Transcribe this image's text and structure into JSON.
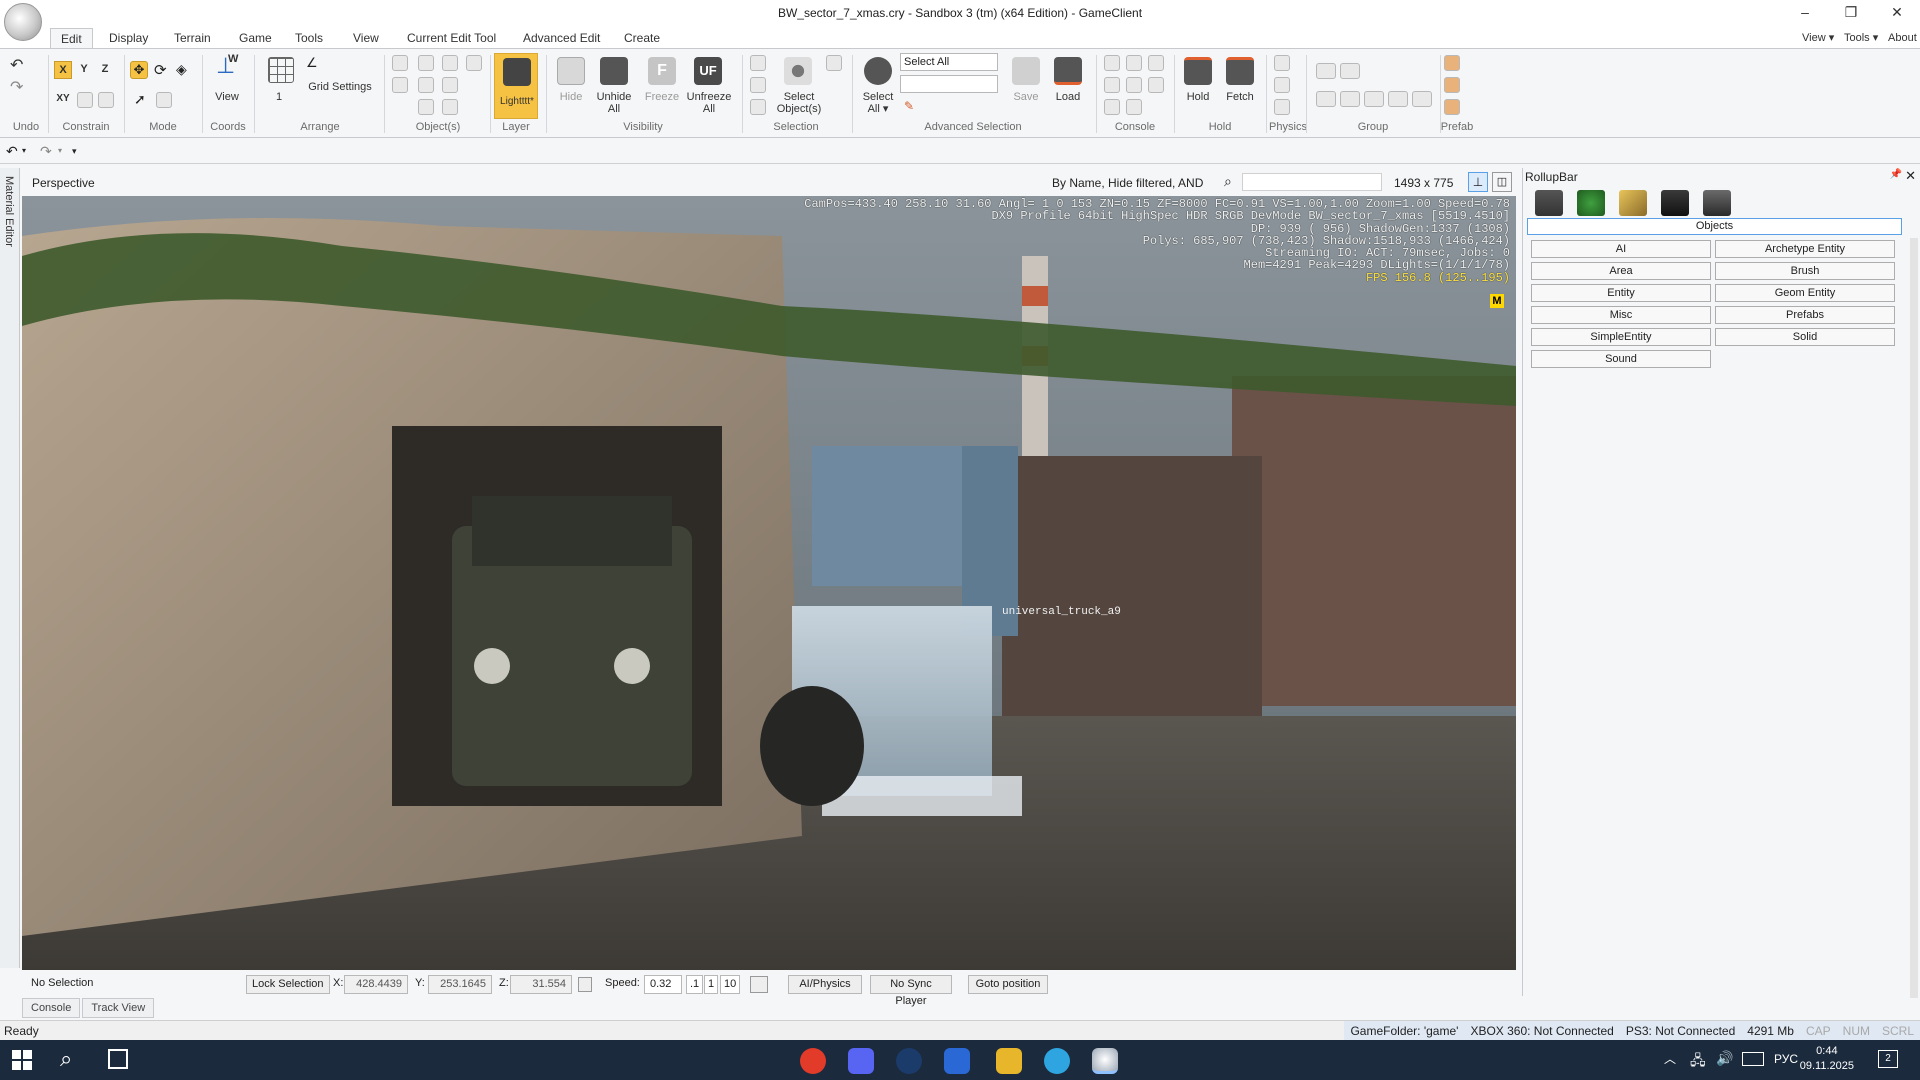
{
  "window": {
    "title": "BW_sector_7_xmas.cry - Sandbox 3 (tm) (x64 Edition) - GameClient",
    "controls": {
      "minimize": "–",
      "maximize": "❐",
      "close": "✕"
    }
  },
  "menu_tabs": [
    "Edit",
    "Display",
    "Terrain",
    "Game",
    "Tools",
    "View",
    "Current Edit Tool",
    "Advanced Edit",
    "Create"
  ],
  "menu_right": [
    "View ▾",
    "Tools ▾",
    "About"
  ],
  "ribbon": {
    "groups": {
      "undo": "Undo",
      "constrain": "Constrain",
      "mode": "Mode",
      "coords": "Coords",
      "arrange": "Arrange",
      "objects": "Object(s)",
      "layer": "Layer",
      "visibility": "Visibility",
      "selection": "Selection",
      "advanced_selection": "Advanced Selection",
      "console": "Console",
      "hold": "Hold",
      "physics": "Physics",
      "group": "Group",
      "prefab": "Prefab"
    },
    "constrain": {
      "x": "X",
      "y": "Y",
      "z": "Z",
      "xy": "XY"
    },
    "coords_view": "View",
    "coords_w": "W",
    "arrange_value": "1",
    "grid_settings": "Grid Settings",
    "layer": "Lightttt*",
    "hide": "Hide",
    "unhide_all": "Unhide\nAll",
    "freeze": "Freeze",
    "freeze_glyph": "F",
    "unfreeze_all": "Unfreeze\nAll",
    "unfreeze_glyph": "UF",
    "select_objects": "Select\nObject(s)",
    "select_all": "Select\nAll ▾",
    "select_combo": "Select All",
    "save": "Save",
    "load": "Load",
    "hold": "Hold",
    "fetch": "Fetch"
  },
  "viewport": {
    "name": "Perspective",
    "filter": "By Name, Hide filtered, AND",
    "resolution": "1493 x 775",
    "hud_lines": [
      "CamPos=433.40 258.10 31.60 Angl= 1 0 153 ZN=0.15 ZF=8000 FC=0.91 VS=1.00,1.00 Zoom=1.00 Speed=0.78",
      "DX9 Profile 64bit HighSpec HDR SRGB DevMode BW_sector_7_xmas [5519.4510]",
      "DP: 939 ( 956) ShadowGen:1337 (1308)",
      "Polys: 685,907 (738,423) Shadow:1518,933 (1466,424)",
      "Streaming IO: ACT: 79msec, Jobs: 0",
      "Mem=4291 Peak=4293 DLights=(1/1/1/78)"
    ],
    "fps": "FPS 156.8 (125..195)",
    "badge": "M",
    "object_label": "universal_truck_a9"
  },
  "side_tab": "Material Editor",
  "rollup": {
    "title": "RollupBar",
    "pin": "📌",
    "close": "✕",
    "category": "Objects",
    "buttons": [
      "AI",
      "Archetype Entity",
      "Area",
      "Brush",
      "Entity",
      "Geom Entity",
      "Misc",
      "Prefabs",
      "SimpleEntity",
      "Solid",
      "Sound"
    ]
  },
  "bottom": {
    "selection": "No Selection",
    "lock": "Lock Selection",
    "x_label": "X:",
    "x": "428.4439",
    "y_label": "Y:",
    "y": "253.1645",
    "z_label": "Z:",
    "z": "31.554",
    "speed_label": "Speed:",
    "speed": "0.32",
    "speed_presets": [
      ".1",
      "1",
      "10"
    ],
    "ai_physics": "AI/Physics",
    "sync": "No Sync Player",
    "goto": "Goto position"
  },
  "console_tabs": [
    "Console",
    "Track View"
  ],
  "status": {
    "ready": "Ready",
    "game_folder": "GameFolder: 'game'",
    "xbox": "XBOX 360: Not Connected",
    "ps3": "PS3: Not Connected",
    "mem": "4291 Mb",
    "cap": "CAP",
    "num": "NUM",
    "scrl": "SCRL"
  },
  "taskbar": {
    "lang": "РУС",
    "time": "0:44",
    "date": "09.11.2025",
    "notifications": "2"
  },
  "colors": {
    "accent": "#f5c243",
    "selection_blue": "#5aa0e6",
    "taskbar": "#1b2a3d",
    "hud_fps": "#ffe445"
  }
}
